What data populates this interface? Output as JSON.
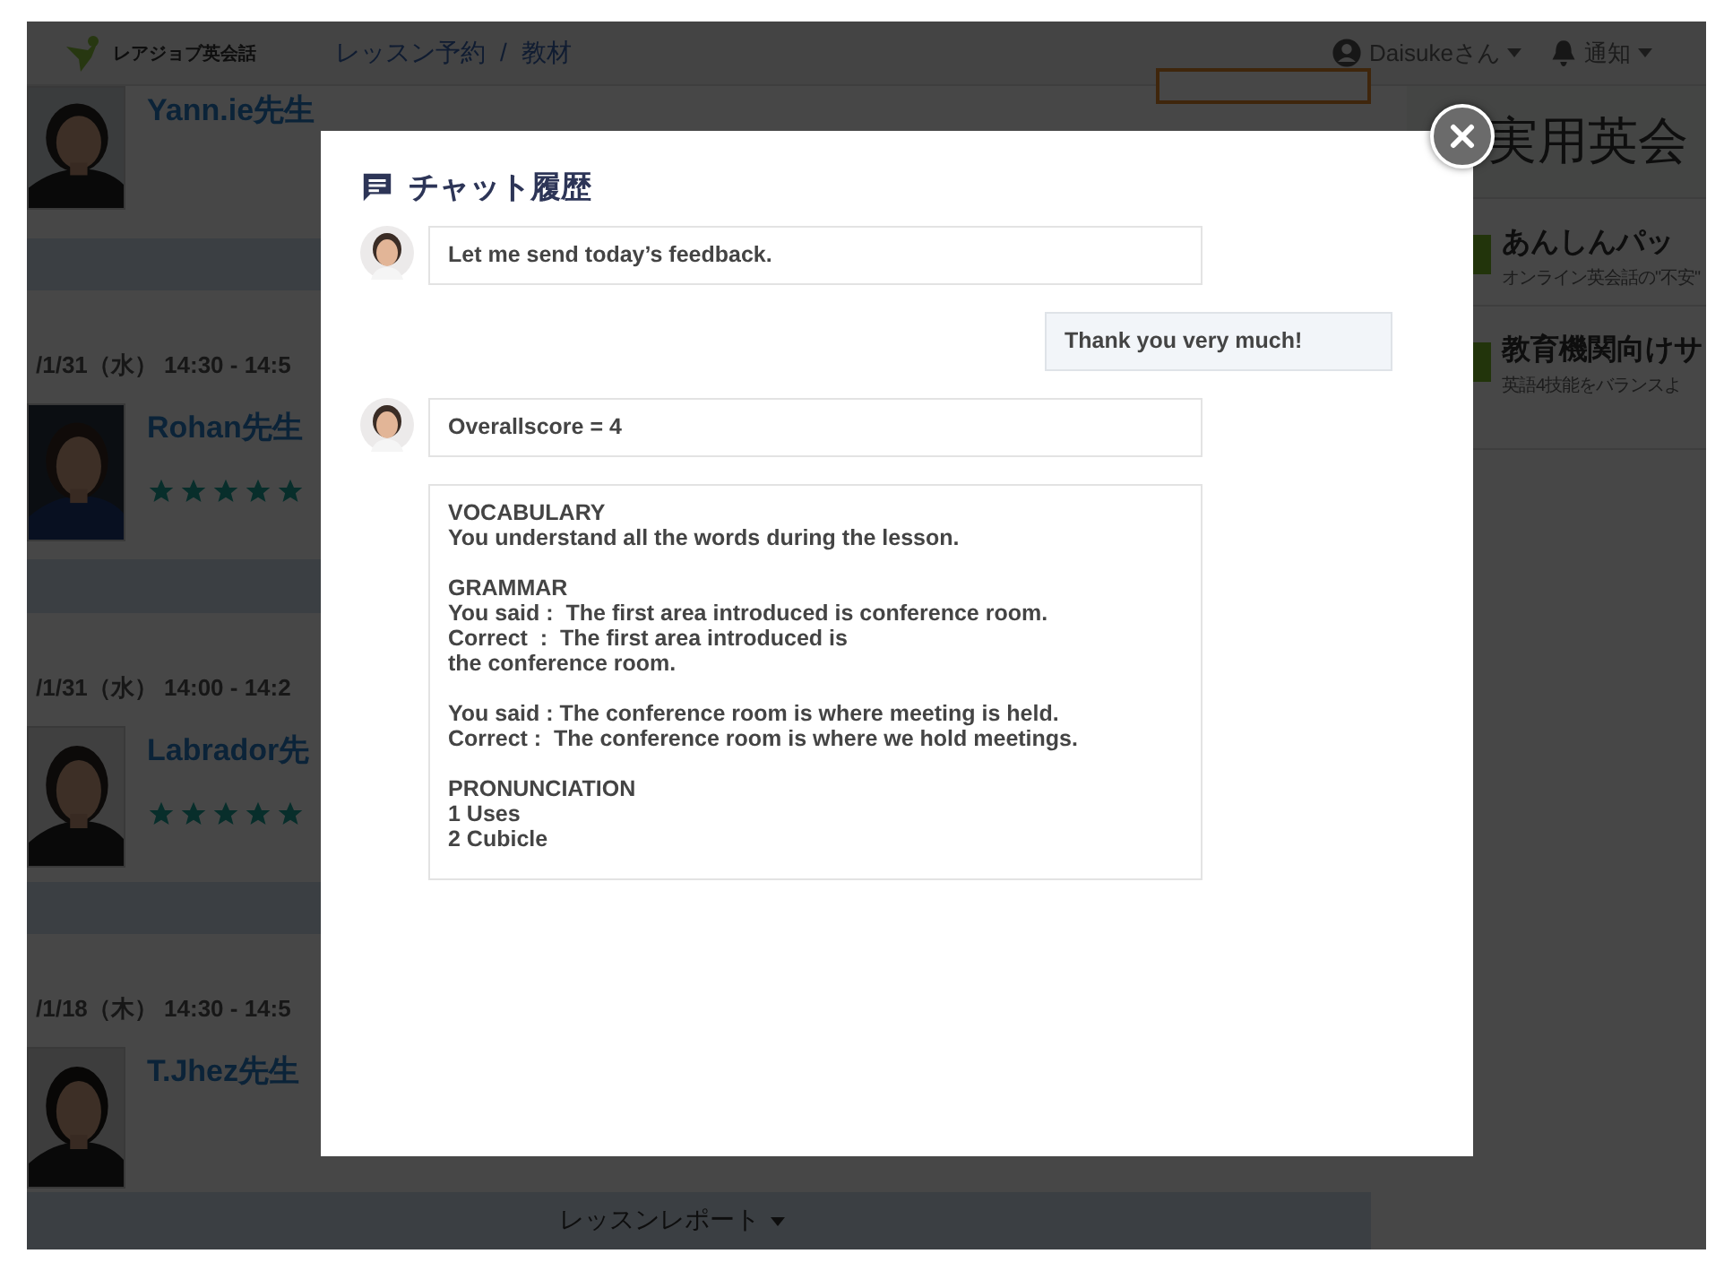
{
  "header": {
    "logo": "レアジョブ英会話",
    "nav": [
      {
        "label": "レッスン予約"
      },
      {
        "label": "教材"
      }
    ],
    "nav_separator": "/",
    "user": "Daisukeさん",
    "notifications": "通知"
  },
  "lessons": [
    {
      "name": "Yann.ie先生"
    },
    {
      "date": "/1/31（水） 14:30 - 14:5",
      "name": "Rohan先生",
      "stars": 5
    },
    {
      "date": "/1/31（水） 14:00 - 14:2",
      "name": "Labrador先",
      "stars": 5
    },
    {
      "date": "/1/18（木） 14:30 - 14:5",
      "name": "T.Jhez先生"
    }
  ],
  "report_button": "レッスンレポート",
  "sidebar": {
    "banner": "実用英会",
    "cards": [
      {
        "title": "あんしんパッ",
        "subtitle": "オンライン英会話の\"不安\""
      },
      {
        "title": "教育機関向けサ",
        "subtitle": "英語4技能をバランスよ"
      }
    ]
  },
  "chat": {
    "title": "チャット履歴",
    "messages": [
      {
        "kind": "teacher",
        "show_avatar": true,
        "text": "Let me send today’s feedback."
      },
      {
        "kind": "user",
        "show_avatar": false,
        "text": "Thank you very much!"
      },
      {
        "kind": "teacher",
        "show_avatar": true,
        "text": "Overallscore = 4"
      },
      {
        "kind": "teacher",
        "show_avatar": false,
        "text": "VOCABULARY\nYou understand all the words during the lesson.\n\nGRAMMAR\nYou said :  The first area introduced is conference room.\nCorrect  :  The first area introduced is\nthe conference room.\n\nYou said : The conference room is where meeting is held.\nCorrect :  The conference room is where we hold meetings.\n\nPRONUNCIATION\n1 Uses\n2 Cubicle"
      }
    ]
  }
}
